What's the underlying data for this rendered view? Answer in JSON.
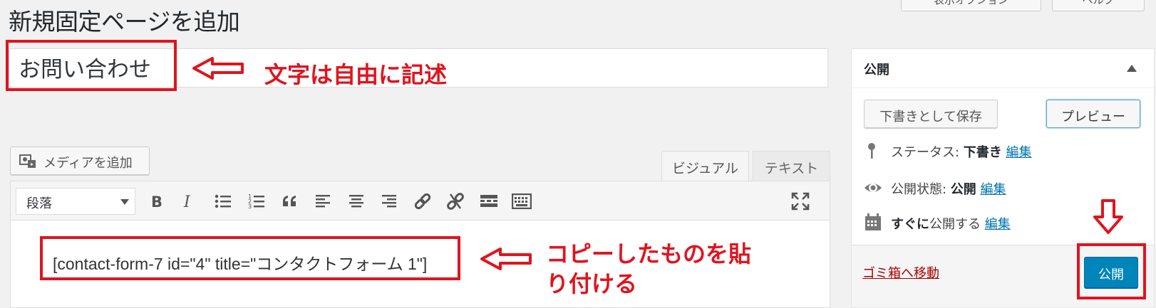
{
  "page": {
    "title": "新規固定ページを追加"
  },
  "top_buttons": [
    {
      "label": "表示オプション"
    },
    {
      "label": "ヘルプ"
    }
  ],
  "title_field": {
    "value": "お問い合わせ"
  },
  "annotations": {
    "title_note": "文字は自由に記述",
    "shortcode_note_line1": "コピーしたものを貼",
    "shortcode_note_line2": "り付ける"
  },
  "editor": {
    "add_media_label": "メディアを追加",
    "tabs": [
      {
        "label": "ビジュアル"
      },
      {
        "label": "テキスト"
      }
    ],
    "format_select_value": "段落",
    "toolbar_icons": [
      "bold-icon",
      "italic-icon",
      "bullet-list-icon",
      "numbered-list-icon",
      "blockquote-icon",
      "align-left-icon",
      "align-center-icon",
      "align-right-icon",
      "insert-link-icon",
      "remove-link-icon",
      "read-more-icon",
      "toolbar-toggle-icon",
      "fullscreen-icon"
    ],
    "content": "[contact-form-7 id=\"4\" title=\"コンタクトフォーム 1\"]"
  },
  "publish_box": {
    "title": "公開",
    "save_draft_label": "下書きとして保存",
    "preview_label": "プレビュー",
    "status_label": "ステータス: ",
    "status_value": "下書き",
    "visibility_label": "公開状態: ",
    "visibility_value": "公開",
    "schedule_value": "すぐに",
    "schedule_label": "公開する",
    "edit_label": "編集",
    "trash_label": "ゴミ箱へ移動",
    "publish_label": "公開"
  },
  "colors": {
    "annotation_red": "#e0141e",
    "publish_blue": "#0085ba",
    "link_blue": "#0073aa"
  }
}
